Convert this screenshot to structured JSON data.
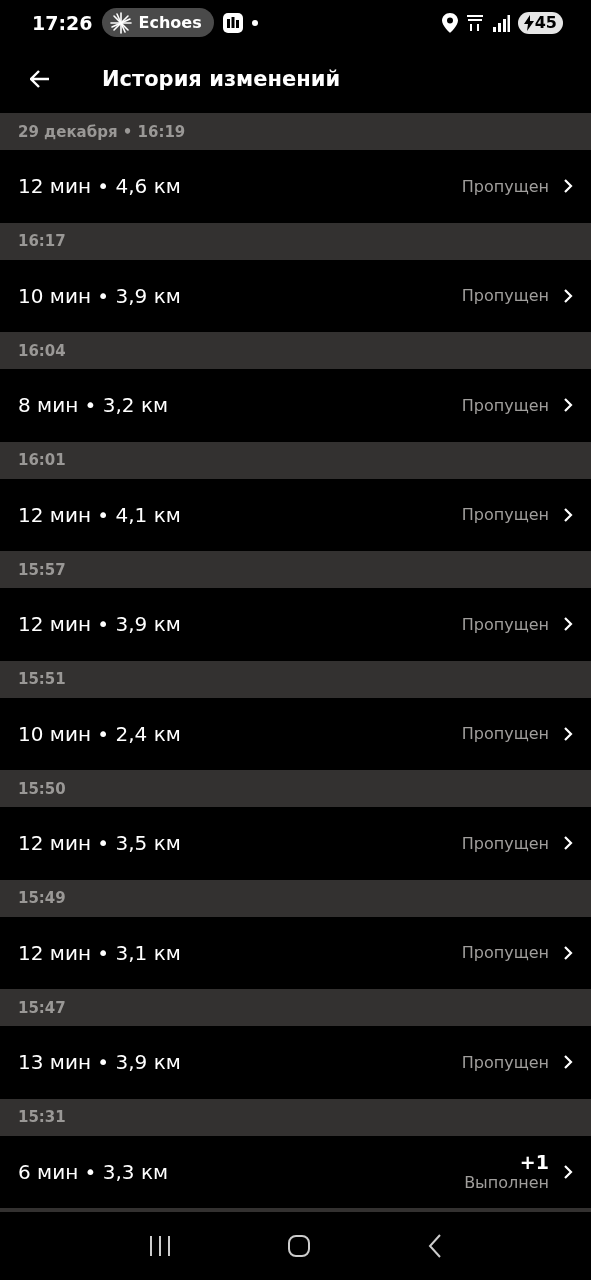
{
  "status_bar": {
    "time": "17:26",
    "media_chip": "Echoes",
    "battery": "45"
  },
  "app_bar": {
    "title": "История изменений"
  },
  "groups": [
    {
      "header": "29 декабря • 16:19",
      "summary": "12 мин • 4,6 км",
      "status": "Пропущен"
    },
    {
      "header": "16:17",
      "summary": "10 мин • 3,9 км",
      "status": "Пропущен"
    },
    {
      "header": "16:04",
      "summary": "8 мин • 3,2 км",
      "status": "Пропущен"
    },
    {
      "header": "16:01",
      "summary": "12 мин • 4,1 км",
      "status": "Пропущен"
    },
    {
      "header": "15:57",
      "summary": "12 мин • 3,9 км",
      "status": "Пропущен"
    },
    {
      "header": "15:51",
      "summary": "10 мин • 2,4 км",
      "status": "Пропущен"
    },
    {
      "header": "15:50",
      "summary": "12 мин • 3,5 км",
      "status": "Пропущен"
    },
    {
      "header": "15:49",
      "summary": "12 мин • 3,1 км",
      "status": "Пропущен"
    },
    {
      "header": "15:47",
      "summary": "13 мин • 3,9 км",
      "status": "Пропущен"
    },
    {
      "header": "15:31",
      "summary": "6 мин • 3,3 км",
      "status": "Выполнен",
      "bonus": "+1"
    }
  ]
}
